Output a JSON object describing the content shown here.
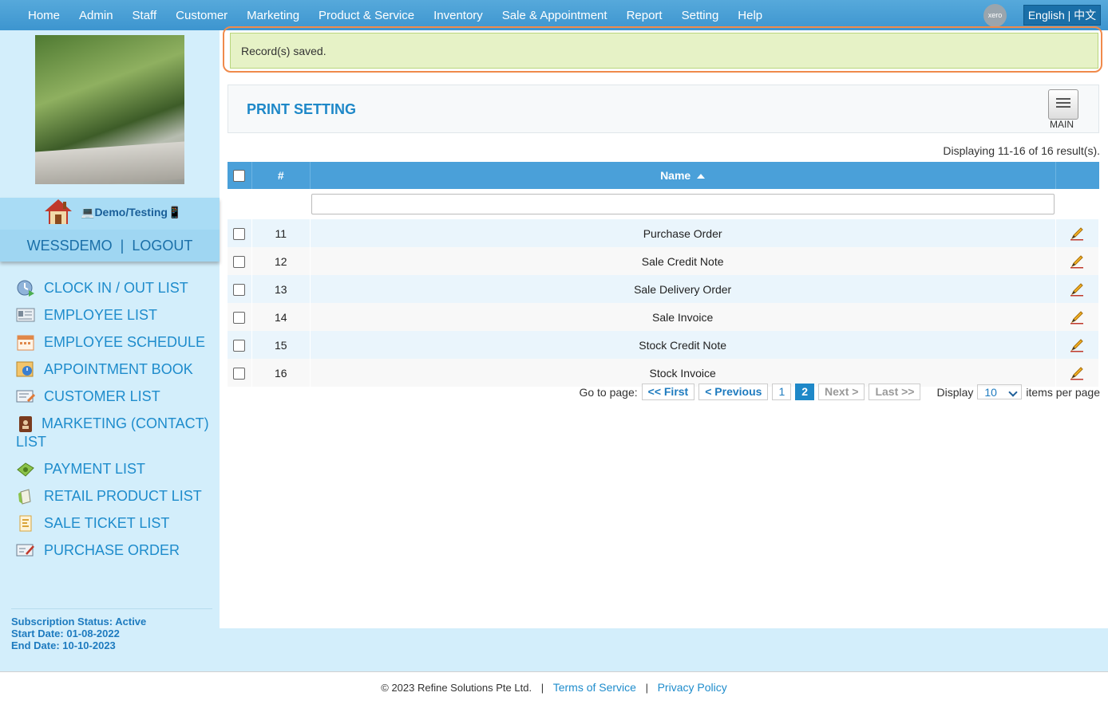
{
  "nav": {
    "items": [
      "Home",
      "Admin",
      "Staff",
      "Customer",
      "Marketing",
      "Product & Service",
      "Inventory",
      "Sale & Appointment",
      "Report",
      "Setting",
      "Help"
    ],
    "xero": "xero",
    "language": "English | 中文"
  },
  "user": {
    "demo_label": "Demo/Testing",
    "username": "WESSDEMO",
    "separator": "|",
    "logout": "LOGOUT"
  },
  "sidebar": {
    "items": [
      {
        "label": "CLOCK IN / OUT LIST",
        "icon": "clock-icon"
      },
      {
        "label": "EMPLOYEE LIST",
        "icon": "id-card-icon"
      },
      {
        "label": "EMPLOYEE SCHEDULE",
        "icon": "calendar-icon"
      },
      {
        "label": "APPOINTMENT BOOK",
        "icon": "appointment-icon"
      },
      {
        "label": "CUSTOMER LIST",
        "icon": "customer-card-icon"
      },
      {
        "label": "MARKETING (CONTACT) LIST",
        "icon": "contact-book-icon"
      },
      {
        "label": "PAYMENT LIST",
        "icon": "payment-icon"
      },
      {
        "label": "RETAIL PRODUCT LIST",
        "icon": "product-box-icon"
      },
      {
        "label": "SALE TICKET LIST",
        "icon": "ticket-icon"
      },
      {
        "label": "PURCHASE ORDER",
        "icon": "purchase-order-icon"
      }
    ]
  },
  "subscription": {
    "status": "Subscription Status: Active",
    "start": "Start Date: 01-08-2022",
    "end": "End Date: 10-10-2023"
  },
  "alert": {
    "message": "Record(s) saved."
  },
  "page": {
    "title": "PRINT SETTING",
    "main_label": "MAIN",
    "summary": "Displaying 11-16 of 16 result(s)."
  },
  "table": {
    "headers": {
      "num": "#",
      "name": "Name"
    },
    "rows": [
      {
        "num": "11",
        "name": "Purchase Order"
      },
      {
        "num": "12",
        "name": "Sale Credit Note"
      },
      {
        "num": "13",
        "name": "Sale Delivery Order"
      },
      {
        "num": "14",
        "name": "Sale Invoice"
      },
      {
        "num": "15",
        "name": "Stock Credit Note"
      },
      {
        "num": "16",
        "name": "Stock Invoice"
      }
    ]
  },
  "pager": {
    "goto": "Go to page:",
    "first": "<< First",
    "prev": "< Previous",
    "page1": "1",
    "page2": "2",
    "next": "Next >",
    "last": "Last >>",
    "display": "Display",
    "per_page_value": "10",
    "items_per_page": "items per page"
  },
  "footer": {
    "copyright": "© 2023 Refine Solutions Pte Ltd.",
    "sep": "|",
    "terms": "Terms of Service",
    "privacy": "Privacy Policy"
  }
}
